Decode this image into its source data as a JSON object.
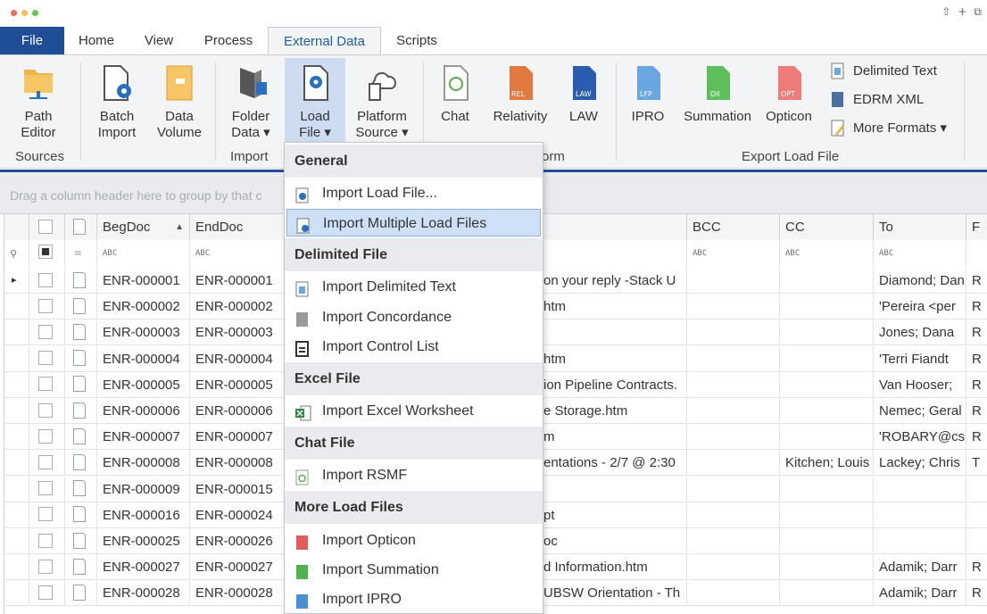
{
  "tabs": [
    "File",
    "Home",
    "View",
    "Process",
    "External Data",
    "Scripts"
  ],
  "ribbon": {
    "path_editor": [
      "Path",
      "Editor"
    ],
    "batch_import": [
      "Batch",
      "Import"
    ],
    "data_volume": [
      "Data",
      "Volume"
    ],
    "folder_data": [
      "Folder",
      "Data ▾"
    ],
    "load_file": [
      "Load",
      "File ▾"
    ],
    "platform_source": [
      "Platform",
      "Source ▾"
    ],
    "chat": "Chat",
    "relativity": "Relativity",
    "law": "LAW",
    "ipro": "IPRO",
    "summation": "Summation",
    "opticon": "Opticon",
    "delimited_text": "Delimited Text",
    "edrm_xml": "EDRM XML",
    "more_formats": "More Formats ▾",
    "icon_tags": {
      "rel": "REL",
      "law": "LAW",
      "lfp": "LFP",
      "dii": "DII",
      "opt": "OPT"
    },
    "groups": {
      "sources": "Sources",
      "import": "Import",
      "import_from_tail": "orm",
      "export": "Export Load File"
    }
  },
  "groupbar_hint": "Drag a column header here to group by that c",
  "grid": {
    "columns": [
      "BegDoc",
      "EndDoc",
      "BCC",
      "CC",
      "To",
      "F"
    ],
    "filter_glyph": "ABC",
    "rows": [
      {
        "beg": "ENR-000001",
        "end": "ENR-000001",
        "mid": "on your reply -Stack U",
        "cc": "",
        "to": "Diamond; Dan",
        "f": "R"
      },
      {
        "beg": "ENR-000002",
        "end": "ENR-000002",
        "mid": "htm",
        "cc": "",
        "to": "'Pereira <per",
        "f": "R"
      },
      {
        "beg": "ENR-000003",
        "end": "ENR-000003",
        "mid": "",
        "cc": "",
        "to": "Jones; Dana",
        "f": "R"
      },
      {
        "beg": "ENR-000004",
        "end": "ENR-000004",
        "mid": "htm",
        "cc": "",
        "to": "'Terri Fiandt",
        "f": "R"
      },
      {
        "beg": "ENR-000005",
        "end": "ENR-000005",
        "mid": "ion Pipeline Contracts.",
        "cc": "",
        "to": "Van Hooser;",
        "f": "R"
      },
      {
        "beg": "ENR-000006",
        "end": "ENR-000006",
        "mid": "e Storage.htm",
        "cc": "",
        "to": "Nemec; Geral",
        "f": "R"
      },
      {
        "beg": "ENR-000007",
        "end": "ENR-000007",
        "mid": "m",
        "cc": "",
        "to": "'ROBARY@cs.",
        "f": "R"
      },
      {
        "beg": "ENR-000008",
        "end": "ENR-000008",
        "mid": "entations - 2/7 @ 2:30",
        "cc": "Kitchen; Louis",
        "to": "Lackey; Chris",
        "f": "T"
      },
      {
        "beg": "ENR-000009",
        "end": "ENR-000015",
        "mid": "",
        "cc": "",
        "to": "",
        "f": ""
      },
      {
        "beg": "ENR-000016",
        "end": "ENR-000024",
        "mid": "pt",
        "cc": "",
        "to": "",
        "f": ""
      },
      {
        "beg": "ENR-000025",
        "end": "ENR-000026",
        "mid": "oc",
        "cc": "",
        "to": "",
        "f": ""
      },
      {
        "beg": "ENR-000027",
        "end": "ENR-000027",
        "mid": "d Information.htm",
        "cc": "",
        "to": "Adamik; Darr",
        "f": "R"
      },
      {
        "beg": "ENR-000028",
        "end": "ENR-000028",
        "mid": "UBSW Orientation - Th",
        "cc": "",
        "to": "Adamik; Darr",
        "f": "R"
      }
    ]
  },
  "menu": {
    "general": "General",
    "import_load_file": "Import Load File...",
    "import_multiple": "Import Multiple Load Files",
    "delimited_file": "Delimited File",
    "import_delimited": "Import Delimited Text",
    "import_concordance": "Import Concordance",
    "import_control_list": "Import Control List",
    "excel_file": "Excel File",
    "import_excel": "Import Excel Worksheet",
    "chat_file": "Chat File",
    "import_rsmf": "Import RSMF",
    "more_load_files": "More Load Files",
    "import_opticon": "Import Opticon",
    "import_summation": "Import Summation",
    "import_ipro": "Import IPRO"
  },
  "colors": {
    "file_tab": "#1f4e97",
    "menu_highlight": "#cde0f5",
    "ribbon_bg": "#f3f4f6"
  }
}
